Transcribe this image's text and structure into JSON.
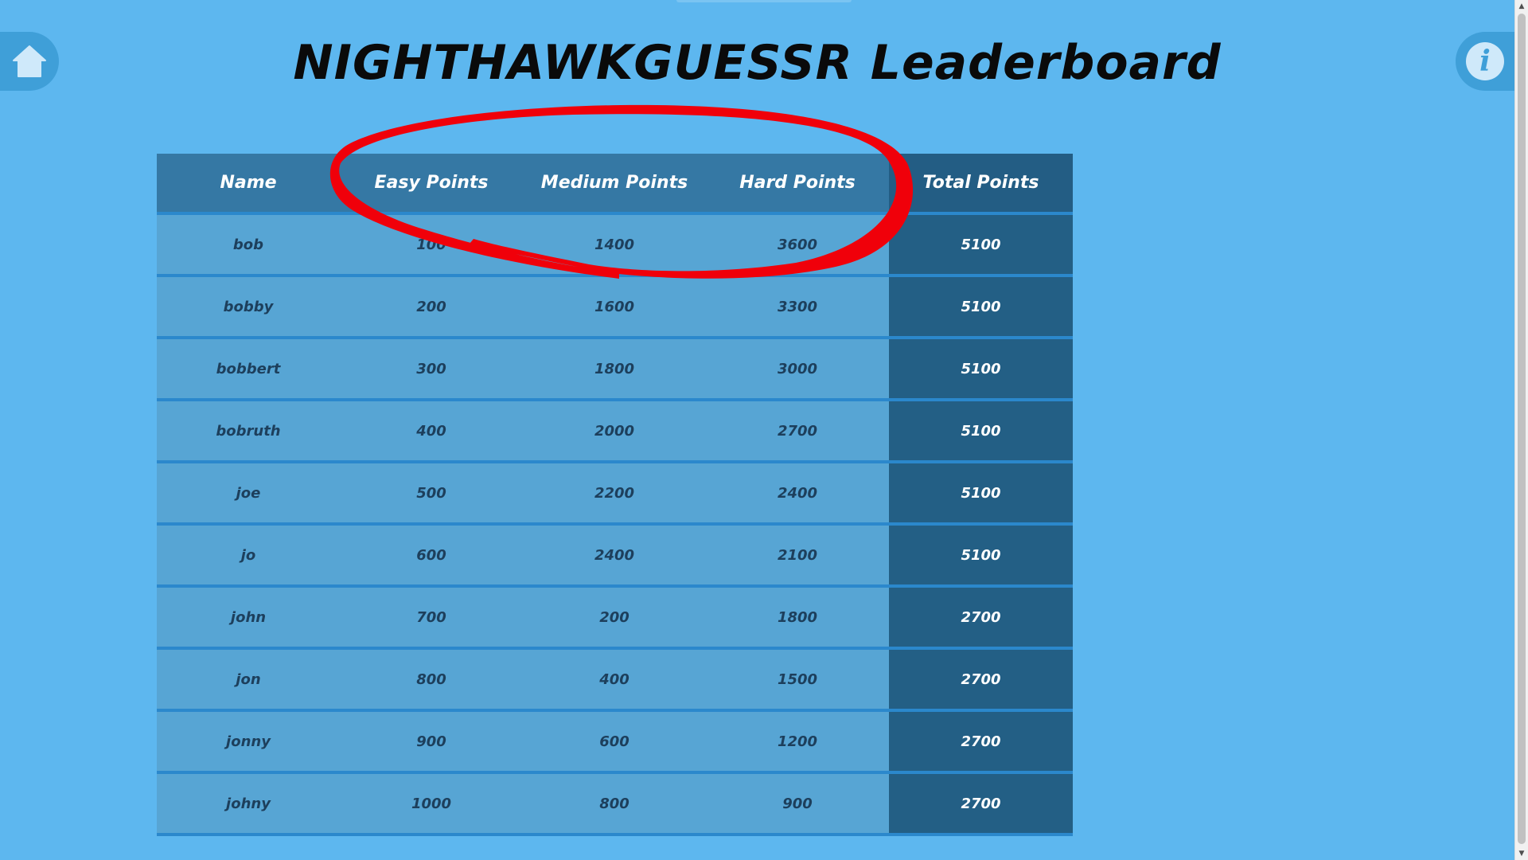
{
  "page": {
    "title": "NIGHTHAWKGUESSR Leaderboard"
  },
  "nav": {
    "home_icon": "home-icon",
    "info_icon": "info-icon",
    "info_glyph": "i"
  },
  "leaderboard": {
    "columns": [
      "Name",
      "Easy Points",
      "Medium Points",
      "Hard Points",
      "Total Points"
    ],
    "rows": [
      [
        "bob",
        "100",
        "1400",
        "3600",
        "5100"
      ],
      [
        "bobby",
        "200",
        "1600",
        "3300",
        "5100"
      ],
      [
        "bobbert",
        "300",
        "1800",
        "3000",
        "5100"
      ],
      [
        "bobruth",
        "400",
        "2000",
        "2700",
        "5100"
      ],
      [
        "joe",
        "500",
        "2200",
        "2400",
        "5100"
      ],
      [
        "jo",
        "600",
        "2400",
        "2100",
        "5100"
      ],
      [
        "john",
        "700",
        "200",
        "1800",
        "2700"
      ],
      [
        "jon",
        "800",
        "400",
        "1500",
        "2700"
      ],
      [
        "jonny",
        "900",
        "600",
        "1200",
        "2700"
      ],
      [
        "johny",
        "1000",
        "800",
        "900",
        "2700"
      ]
    ]
  },
  "colors": {
    "background": "#5db7ef",
    "header": "#3578a4",
    "row": "#57a5d4",
    "total_column": "#235f85",
    "annotation": "#f0000a"
  }
}
